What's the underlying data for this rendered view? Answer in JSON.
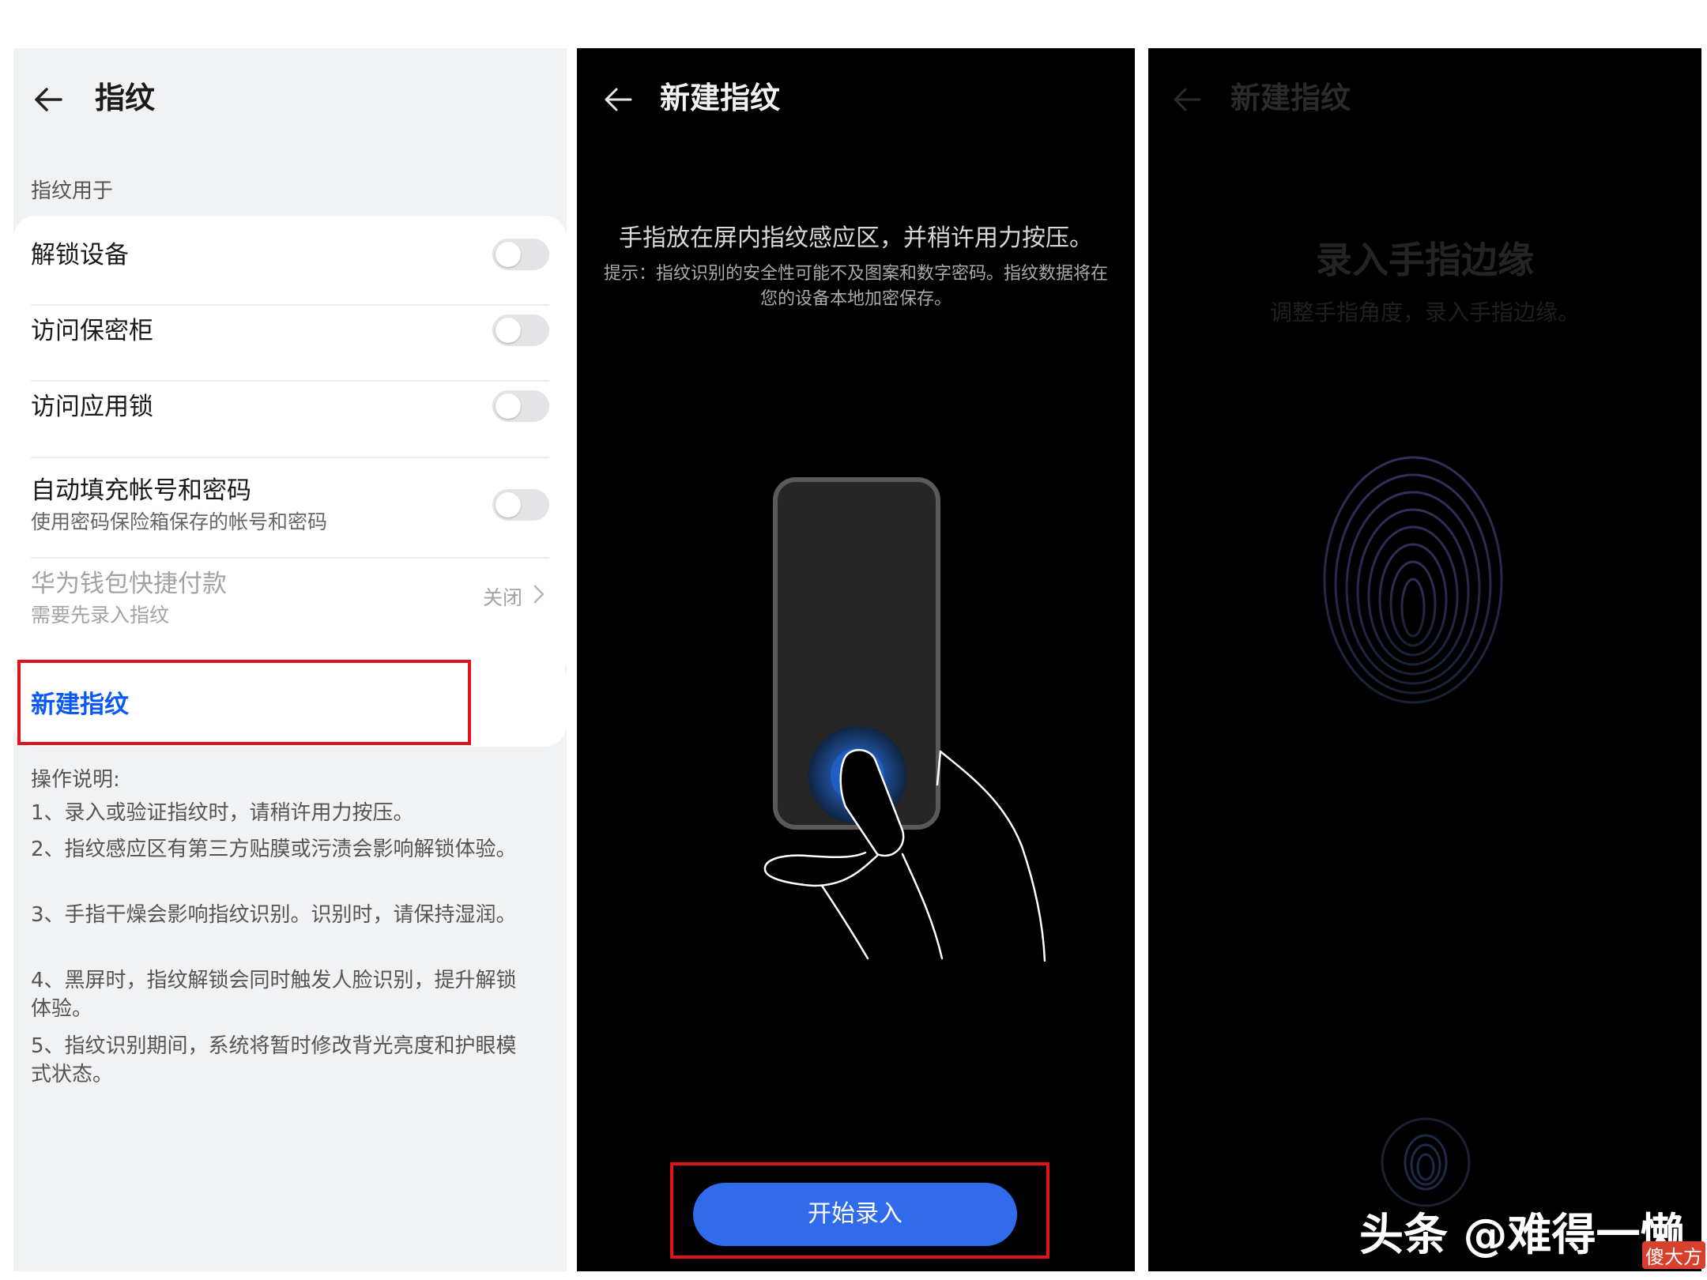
{
  "settings": {
    "title": "指纹",
    "section_label": "指纹用于",
    "rows": [
      {
        "title": "解锁设备",
        "toggle": false
      },
      {
        "title": "访问保密柜",
        "toggle": false
      },
      {
        "title": "访问应用锁",
        "toggle": false
      },
      {
        "title": "自动填充帐号和密码",
        "subtitle": "使用密码保险箱保存的帐号和密码",
        "toggle": false
      },
      {
        "title": "华为钱包快捷付款",
        "subtitle": "需要先录入指纹",
        "value": "关闭",
        "disabled": true
      }
    ],
    "new_fingerprint": "新建指纹",
    "instructions_title": "操作说明:",
    "instructions": [
      "1、录入或验证指纹时，请稍许用力按压。",
      "2、指纹感应区有第三方贴膜或污渍会影响解锁体验。",
      "3、手指干燥会影响指纹识别。识别时，请保持湿润。",
      "4、黑屏时，指纹解锁会同时触发人脸识别，提升解锁体验。",
      "5、指纹识别期间，系统将暂时修改背光亮度和护眼模式状态。"
    ]
  },
  "enroll": {
    "title": "新建指纹",
    "instruction": "手指放在屏内指纹感应区，并稍许用力按压。",
    "tip": "提示：指纹识别的安全性可能不及图案和数字密码。指纹数据将在您的设备本地加密保存。",
    "start_button": "开始录入"
  },
  "edge": {
    "title": "新建指纹",
    "heading": "录入手指边缘",
    "subheading": "调整手指角度，录入手指边缘。"
  },
  "watermark": "头条 @难得一懒",
  "logo_badge": "傻大方",
  "colors": {
    "accent_blue": "#0a59f7",
    "button_blue": "#2f6bea",
    "highlight_red": "#e0121b",
    "toggle_off": "#e4e4e6"
  }
}
